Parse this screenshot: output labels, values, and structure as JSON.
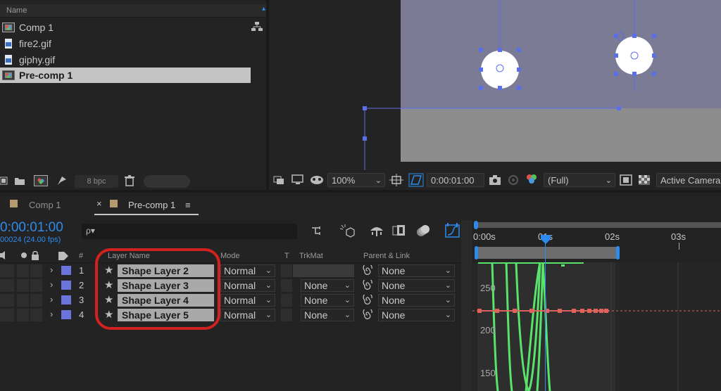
{
  "project": {
    "header_name": "Name",
    "items": [
      {
        "label": "Comp 1",
        "selected": false,
        "icon": "composition-icon"
      },
      {
        "label": "fire2.gif",
        "selected": false,
        "icon": "image-file-icon"
      },
      {
        "label": "giphy.gif",
        "selected": false,
        "icon": "image-file-icon"
      },
      {
        "label": "Pre-comp 1",
        "selected": true,
        "icon": "composition-icon"
      }
    ],
    "bpc_label": "8 bpc"
  },
  "viewer": {
    "zoom": "100%",
    "timecode": "0:00:01:00",
    "resolution": "(Full)",
    "camera": "Active Camera"
  },
  "timeline": {
    "tabs": [
      {
        "label": "Comp 1",
        "active": false
      },
      {
        "label": "Pre-comp 1",
        "active": true
      }
    ],
    "menu_icon": "≡",
    "close_icon": "×",
    "current_time": "0:00:01:00",
    "frame_info": "00024 (24.00 fps)",
    "search_icon": "ρ▾",
    "columns": {
      "num": "#",
      "layer_name": "Layer Name",
      "mode": "Mode",
      "t": "T",
      "trkmat": "TrkMat",
      "parent": "Parent & Link"
    },
    "layers": [
      {
        "num": "1",
        "name": "Shape Layer 2",
        "mode": "Normal",
        "trkmat": "",
        "parent": "None"
      },
      {
        "num": "2",
        "name": "Shape Layer 3",
        "mode": "Normal",
        "trkmat": "None",
        "parent": "None"
      },
      {
        "num": "3",
        "name": "Shape Layer 4",
        "mode": "Normal",
        "trkmat": "None",
        "parent": "None"
      },
      {
        "num": "4",
        "name": "Shape Layer 5",
        "mode": "Normal",
        "trkmat": "None",
        "parent": "None"
      }
    ],
    "ruler": [
      "0:00s",
      "01s",
      "02s",
      "03s"
    ],
    "graph_values": [
      "250",
      "200",
      "150"
    ]
  },
  "colors": {
    "accent": "#2d8ceb",
    "label": "#6b74d9",
    "curve": "#59e36a",
    "speed_line": "#e0625c",
    "annotation": "#d0231f"
  }
}
